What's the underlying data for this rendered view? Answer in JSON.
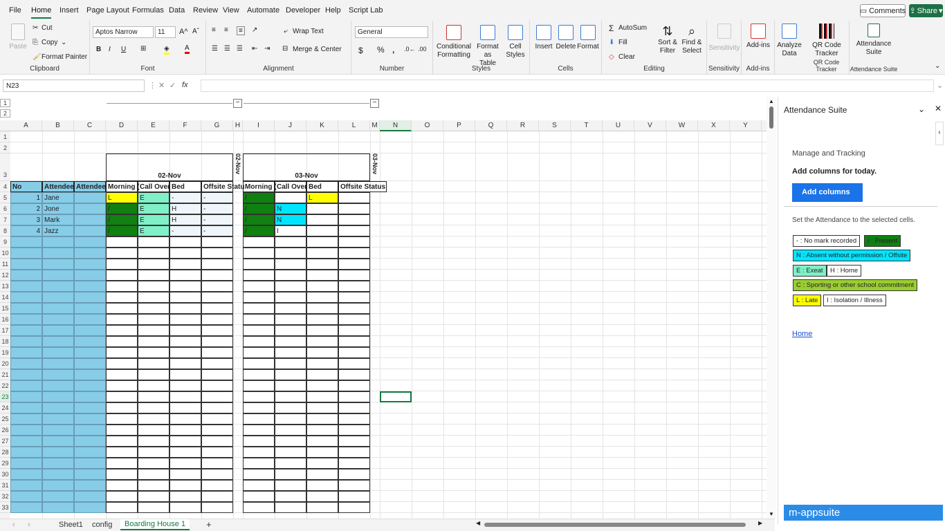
{
  "menu": {
    "file": "File",
    "home": "Home",
    "insert": "Insert",
    "page_layout": "Page Layout",
    "formulas": "Formulas",
    "data": "Data",
    "review": "Review",
    "view": "View",
    "automate": "Automate",
    "developer": "Developer",
    "help": "Help",
    "script_lab": "Script Lab",
    "comments": "Comments",
    "share": "Share"
  },
  "ribbon": {
    "paste": "Paste",
    "cut": "Cut",
    "copy": "Copy",
    "format_painter": "Format Painter",
    "clipboard": "Clipboard",
    "font_name": "Aptos Narrow",
    "font_size": "11",
    "font": "Font",
    "wrap_text": "Wrap Text",
    "merge_center": "Merge & Center",
    "alignment": "Alignment",
    "number_format": "General",
    "number": "Number",
    "conditional_formatting_1": "Conditional",
    "conditional_formatting_2": "Formatting",
    "format_as_table_1": "Format as",
    "format_as_table_2": "Table",
    "cell_styles_1": "Cell",
    "cell_styles_2": "Styles",
    "styles": "Styles",
    "insert": "Insert",
    "delete": "Delete",
    "format": "Format",
    "cells": "Cells",
    "autosum": "AutoSum",
    "fill": "Fill",
    "clear": "Clear",
    "sort_filter_1": "Sort &",
    "sort_filter_2": "Filter",
    "find_select_1": "Find &",
    "find_select_2": "Select",
    "editing": "Editing",
    "sensitivity": "Sensitivity",
    "sensitivity_group": "Sensitivity",
    "addins": "Add-ins",
    "addins_group": "Add-ins",
    "analyze_data_1": "Analyze",
    "analyze_data_2": "Data",
    "qr_1": "QR Code",
    "qr_2": "Tracker",
    "qr_group": "QR Code Tracker",
    "att_1": "Attendance",
    "att_2": "Suite",
    "att_group": "Attendance Suite"
  },
  "formula_bar": {
    "name_box": "N23",
    "fx": "fx"
  },
  "columns": [
    "A",
    "B",
    "C",
    "D",
    "E",
    "F",
    "G",
    "H",
    "I",
    "J",
    "K",
    "L",
    "M",
    "N",
    "O",
    "P",
    "Q",
    "R",
    "S",
    "T",
    "U",
    "V",
    "W",
    "X",
    "Y"
  ],
  "outline_rows": [
    "1",
    "2"
  ],
  "rows": [
    "1",
    "2",
    "3",
    "4",
    "5",
    "6",
    "7",
    "8",
    "9",
    "10",
    "11",
    "12",
    "13",
    "14",
    "15",
    "16",
    "17",
    "18",
    "19",
    "20",
    "21",
    "22",
    "23",
    "24",
    "25",
    "26",
    "27",
    "28",
    "29",
    "30",
    "31",
    "32",
    "33"
  ],
  "sheet": {
    "date1": "02-Nov",
    "date2": "03-Nov",
    "date1_vert": "02-Nov",
    "date2_vert": "03-Nov",
    "headers": [
      "No",
      "Attendee",
      "Attendee",
      "Morning (",
      "Call Over",
      "Bed",
      "Offsite Statu",
      "Morning (",
      "Call Over",
      "Bed",
      "Offsite Status"
    ],
    "records": [
      {
        "no": "1",
        "name": "Jane",
        "d": "L",
        "e": "E",
        "f": "-",
        "g": "-",
        "i": "/",
        "j": "",
        "k": "L",
        "l": ""
      },
      {
        "no": "2",
        "name": "Jone",
        "d": "/",
        "e": "E",
        "f": "H",
        "g": "-",
        "i": "/",
        "j": "N",
        "k": "",
        "l": ""
      },
      {
        "no": "3",
        "name": "Mark",
        "d": "/",
        "e": "E",
        "f": "H",
        "g": "-",
        "i": "/",
        "j": "N",
        "k": "",
        "l": ""
      },
      {
        "no": "4",
        "name": "Jazz",
        "d": "/",
        "e": "E",
        "f": "-",
        "g": "-",
        "i": "/",
        "j": "I",
        "k": "",
        "l": ""
      }
    ]
  },
  "pane": {
    "title": "Attendance Suite",
    "subtitle": "Manage and Tracking",
    "add_prompt": "Add columns for today.",
    "add_button": "Add columns",
    "set_prompt": "Set the Attendance to the selected cells.",
    "tags": {
      "no_mark": "- : No mark recorded",
      "present": "/ : Present",
      "absent": "N : Absent without permission / Offsite",
      "exeat": "E : Exeat",
      "home": "H : Home",
      "sporting": "C : Sporting or other school commitment",
      "late": "L : Late",
      "isolation": "I : Isolation / Illness"
    },
    "home_link": "Home",
    "footer": "m-appsuite"
  },
  "tabs": {
    "sheet1": "Sheet1",
    "config": "config",
    "boarding": "Boarding House 1",
    "add": "+"
  },
  "colors": {
    "accent": "#137b40",
    "pane_blue": "#1a73e8",
    "present": "#108010",
    "exeat": "#7ff0c8",
    "absent": "#00e5ff",
    "late": "#ffff00",
    "attendee_fill": "#87cde8",
    "sporting": "#9acd32"
  }
}
